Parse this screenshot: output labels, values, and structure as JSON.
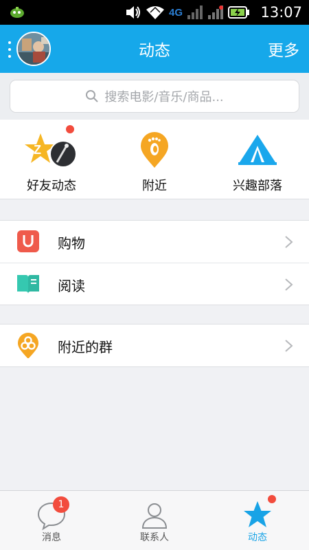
{
  "status_bar": {
    "network_label": "4G",
    "time": "13:07"
  },
  "header": {
    "title": "动态",
    "more_label": "更多"
  },
  "search": {
    "placeholder": "搜索电影/音乐/商品..."
  },
  "quick_items": [
    {
      "label": "好友动态",
      "icon": "qzone-star-icon",
      "has_dot": true
    },
    {
      "label": "附近",
      "icon": "footprint-pin-icon"
    },
    {
      "label": "兴趣部落",
      "icon": "tent-icon"
    }
  ],
  "list_group_1": [
    {
      "label": "购物",
      "icon": "shopping-bag-icon"
    },
    {
      "label": "阅读",
      "icon": "book-icon"
    }
  ],
  "list_group_2": [
    {
      "label": "附近的群",
      "icon": "group-pin-icon"
    }
  ],
  "bottom_nav": {
    "messages_label": "消息",
    "messages_badge": "1",
    "contacts_label": "联系人",
    "dynamics_label": "动态"
  },
  "colors": {
    "header_bg": "#16a8ea",
    "accent_blue": "#18a3e6",
    "badge_red": "#f24c3d",
    "orange": "#f5a623",
    "shopping_red": "#ef5a4b",
    "reading_teal": "#35c8b0"
  }
}
